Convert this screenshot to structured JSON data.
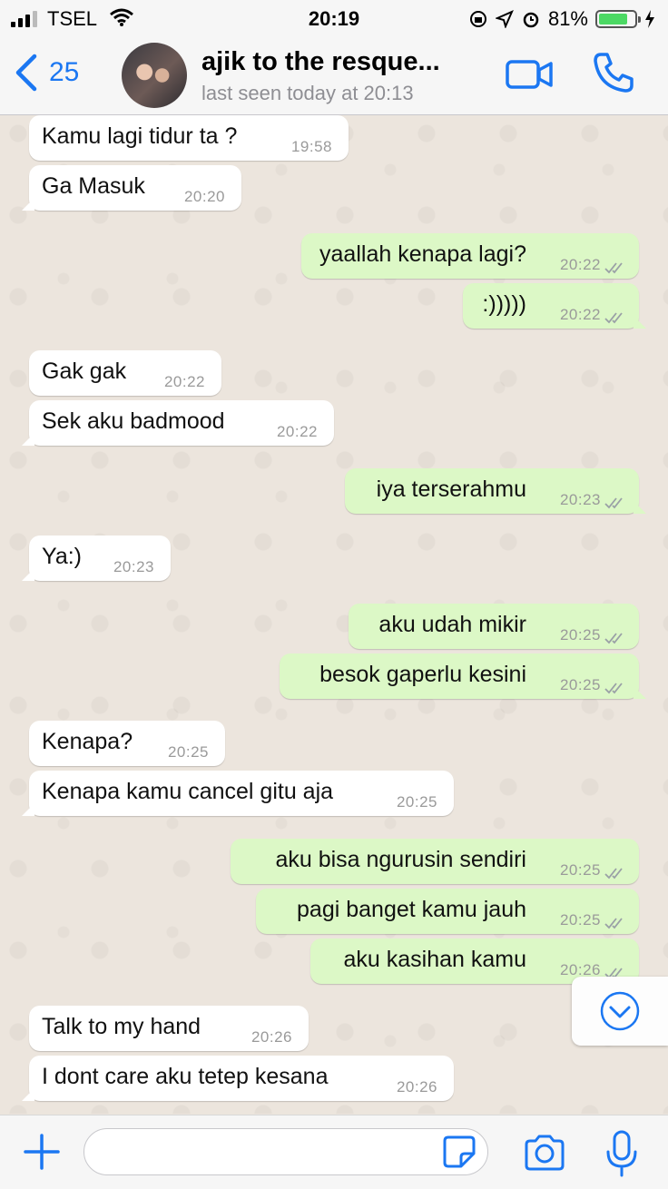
{
  "status_bar": {
    "carrier": "TSEL",
    "time": "20:19",
    "battery": "81%",
    "battery_level": 0.81
  },
  "header": {
    "back_count": "25",
    "contact_name": "ajik to the resque...",
    "last_seen": "last seen today at 20:13"
  },
  "messages": [
    {
      "dir": "in",
      "text": "Kamu lagi tidur ta ?",
      "time": "19:58"
    },
    {
      "dir": "in",
      "text": "Ga Masuk",
      "time": "20:20"
    },
    {
      "dir": "out",
      "text": "yaallah kenapa lagi?",
      "time": "20:22"
    },
    {
      "dir": "out",
      "text": ":)))))",
      "time": "20:22"
    },
    {
      "dir": "in",
      "text": "Gak gak",
      "time": "20:22"
    },
    {
      "dir": "in",
      "text": "Sek aku badmood",
      "time": "20:22"
    },
    {
      "dir": "out",
      "text": "iya terserahmu",
      "time": "20:23"
    },
    {
      "dir": "in",
      "text": "Ya:)",
      "time": "20:23"
    },
    {
      "dir": "out",
      "text": "aku udah mikir",
      "time": "20:25"
    },
    {
      "dir": "out",
      "text": "besok gaperlu kesini",
      "time": "20:25"
    },
    {
      "dir": "in",
      "text": "Kenapa?",
      "time": "20:25"
    },
    {
      "dir": "in",
      "text": "Kenapa kamu cancel gitu aja",
      "time": "20:25"
    },
    {
      "dir": "out",
      "text": "aku bisa ngurusin sendiri",
      "time": "20:25"
    },
    {
      "dir": "out",
      "text": "pagi banget kamu jauh",
      "time": "20:25"
    },
    {
      "dir": "out",
      "text": "aku kasihan kamu",
      "time": "20:26"
    },
    {
      "dir": "in",
      "text": "Talk to my hand",
      "time": "20:26"
    },
    {
      "dir": "in",
      "text": "I dont care aku tetep kesana",
      "time": "20:26"
    }
  ],
  "input": {
    "placeholder": ""
  },
  "colors": {
    "accent": "#1b77f2",
    "outgoing_bubble": "#dcf8c6",
    "incoming_bubble": "#ffffff",
    "chat_background": "#ece5dd"
  }
}
